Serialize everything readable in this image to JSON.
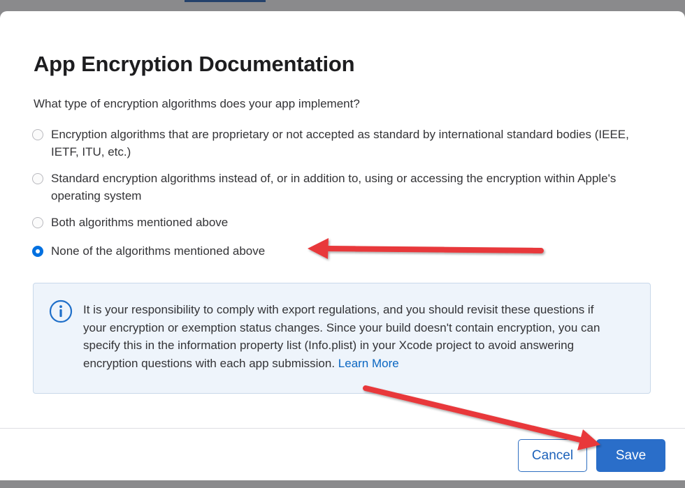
{
  "dialog": {
    "title": "App Encryption Documentation",
    "question": "What type of encryption algorithms does your app implement?",
    "options": [
      {
        "label": "Encryption algorithms that are proprietary or not accepted as standard by international standard bodies (IEEE, IETF, ITU, etc.)",
        "selected": false
      },
      {
        "label": "Standard encryption algorithms instead of, or in addition to, using or accessing the encryption within Apple's operating system",
        "selected": false
      },
      {
        "label": "Both algorithms mentioned above",
        "selected": false
      },
      {
        "label": "None of the algorithms mentioned above",
        "selected": true
      }
    ],
    "info": {
      "icon": "info-icon",
      "text": "It is your responsibility to comply with export regulations, and you should revisit these questions if your encryption or exemption status changes. Since your build doesn't contain encryption, you can specify this in the information property list (Info.plist) in your Xcode project to avoid answering encryption questions with each app submission.",
      "link_label": "Learn More"
    },
    "buttons": {
      "cancel_label": "Cancel",
      "save_label": "Save"
    }
  },
  "annotations": {
    "arrow_color": "#e8393a"
  },
  "colors": {
    "accent": "#2a6ec9",
    "radio_selected": "#0070e0",
    "info_background": "#eef4fb",
    "link": "#0a66c2"
  }
}
